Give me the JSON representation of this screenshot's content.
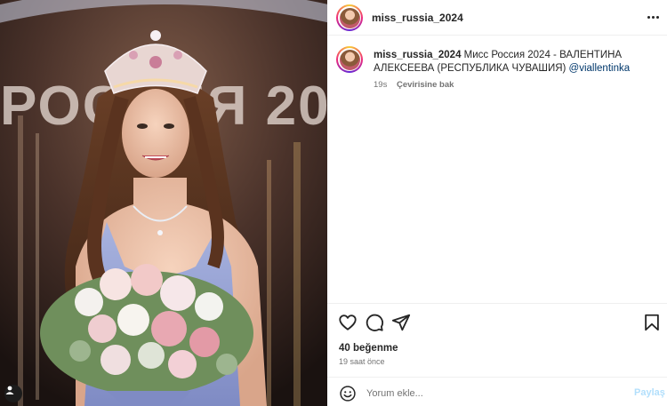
{
  "post": {
    "username": "miss_russia_2024",
    "caption_text": " Мисс Россия 2024 - ВАЛЕНТИНА АЛЕКСЕЕВА (РЕСПУБЛИКА ЧУВАШИЯ) ",
    "caption_mention": "@viallentinka",
    "caption_age": "19s",
    "see_translation": "Çevirisine bak",
    "likes": "40 beğenme",
    "timestamp": "19 saat önce"
  },
  "photo": {
    "backdrop_text": "РОССИЯ 20",
    "description_icon": "user-tag-icon"
  },
  "actions": {
    "like_icon": "heart-icon",
    "comment_icon": "comment-icon",
    "share_icon": "send-icon",
    "save_icon": "bookmark-icon"
  },
  "comment": {
    "placeholder": "Yorum ekle...",
    "post_label": "Paylaş",
    "emoji_icon": "emoji-icon"
  },
  "colors": {
    "link": "#00376b",
    "secondary_text": "#737373",
    "post_disabled": "#b2dffc"
  }
}
